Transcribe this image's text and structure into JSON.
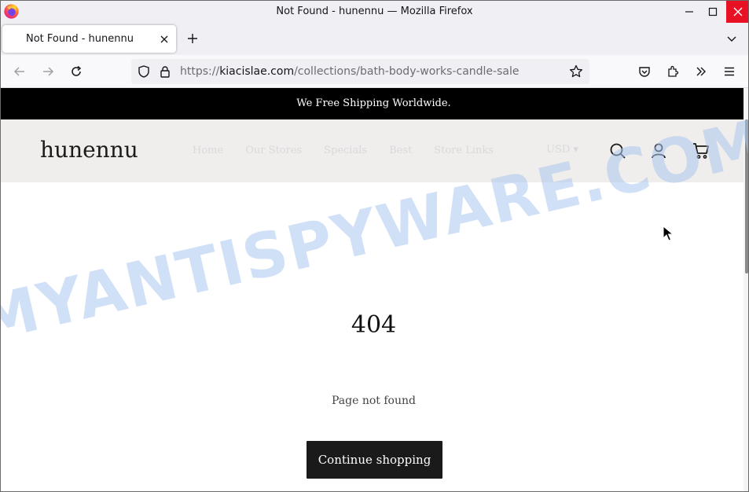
{
  "window": {
    "title": "Not Found - hunennu — Mozilla Firefox"
  },
  "tabs": [
    {
      "label": "Not Found - hunennu",
      "active": true
    }
  ],
  "urlbar": {
    "scheme": "https://",
    "host": "kiacislae.com",
    "path": "/collections/bath-body-works-candle-sale"
  },
  "site": {
    "announcement": "We Free Shipping Worldwide.",
    "logo": "hunennu",
    "nav": [
      "Home",
      "Our Stores",
      "Specials",
      "Best",
      "Store Links"
    ],
    "currency": "USD ▾"
  },
  "error": {
    "code": "404",
    "message": "Page not found",
    "cta_label": "Continue shopping"
  },
  "watermark": "MYANTISPYWARE.COM",
  "colors": {
    "close_button": "#e81123",
    "announcement_bg": "#000000",
    "header_bg": "#efeeec",
    "cta_bg": "#1a1a1a",
    "watermark": "#a9c6ee"
  }
}
